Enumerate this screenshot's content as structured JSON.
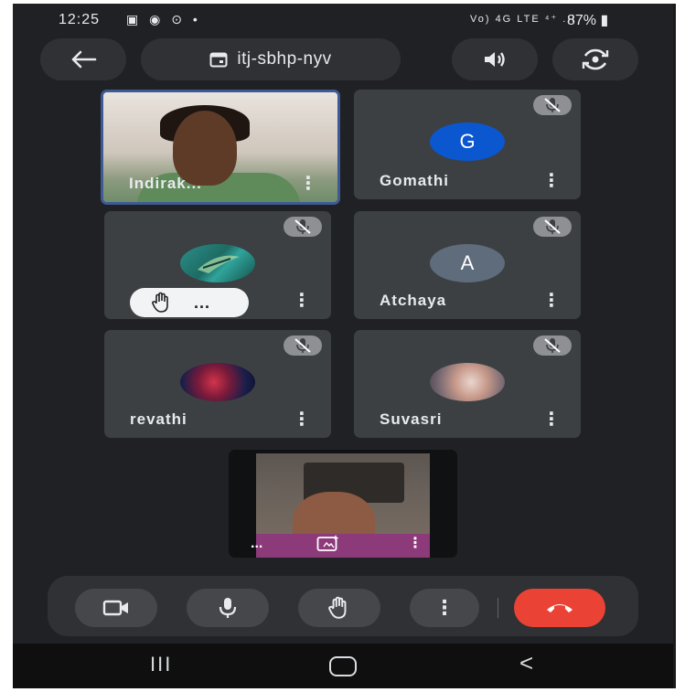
{
  "status_bar": {
    "time": "12:25",
    "left_icons": "▣ ◉ ⊙ •",
    "network_text": "Vo) 4G LTE ⁴⁺ .ıl",
    "battery": "87%"
  },
  "top_bar": {
    "meeting_code": "itj-sbhp-nyv",
    "back_icon": "arrow-back-icon",
    "speaker_icon": "speaker-icon",
    "switch_camera_icon": "switch-camera-icon"
  },
  "participants": [
    {
      "name": "Indirak...",
      "muted": false,
      "video": true,
      "active_speaker": true
    },
    {
      "name": "Gomathi",
      "avatar_letter": "G",
      "avatar_color": "#0b57d0",
      "muted": true
    },
    {
      "name": "",
      "muted": true,
      "avatar_image": true,
      "hand_raised": true,
      "hand_more": "..."
    },
    {
      "name": "Atchaya",
      "avatar_letter": "A",
      "avatar_color": "#5f6c7b",
      "muted": true
    },
    {
      "name": "revathi",
      "muted": true,
      "avatar_image": true
    },
    {
      "name": "Suvasri",
      "muted": true,
      "avatar_image": true
    }
  ],
  "tile_menu_glyph": "⋮",
  "self_view": {
    "left_dots": "...",
    "right_dots": "⋮"
  },
  "controls": {
    "camera_icon": "camera-icon",
    "mic_icon": "mic-icon",
    "raise_hand_icon": "raise-hand-icon",
    "more_icon": "more-options-icon",
    "end_call_icon": "end-call-icon",
    "more_glyph": "⋮",
    "end_call_color": "#ea4335"
  },
  "nav_bar": {
    "recents": "III",
    "back": "<"
  }
}
